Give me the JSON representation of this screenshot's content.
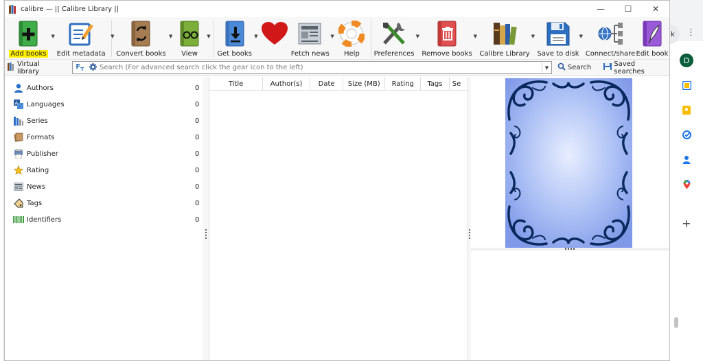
{
  "window": {
    "title": "calibre — || Calibre Library ||",
    "controls": {
      "minimize": "—",
      "maximize": "☐",
      "close": "✕"
    }
  },
  "toolbar": {
    "items": [
      {
        "label": "Add books",
        "highlighted": true,
        "dropdown": true
      },
      {
        "label": "Edit metadata",
        "dropdown": true
      },
      {
        "label": "Convert books",
        "dropdown": true
      },
      {
        "label": "View",
        "dropdown": true
      },
      {
        "label": "Get books",
        "dropdown": true
      },
      {
        "label": "",
        "dropdown": false
      },
      {
        "label": "Fetch news",
        "dropdown": true
      },
      {
        "label": "Help",
        "dropdown": false
      },
      {
        "label": "Preferences",
        "dropdown": true
      },
      {
        "label": "Remove books",
        "dropdown": true
      },
      {
        "label": "Calibre Library",
        "dropdown": true
      },
      {
        "label": "Save to disk",
        "dropdown": true
      },
      {
        "label": "Connect/share",
        "dropdown": false
      },
      {
        "label": "Edit book",
        "dropdown": false
      }
    ]
  },
  "searchbar": {
    "virtual_library": "Virtual library",
    "placeholder": "Search (For advanced search click the gear icon to the left)",
    "search_label": "Search",
    "saved_searches_label": "Saved searches"
  },
  "tag_browser": {
    "items": [
      {
        "label": "Authors",
        "count": "0"
      },
      {
        "label": "Languages",
        "count": "0"
      },
      {
        "label": "Series",
        "count": "0"
      },
      {
        "label": "Formats",
        "count": "0"
      },
      {
        "label": "Publisher",
        "count": "0"
      },
      {
        "label": "Rating",
        "count": "0"
      },
      {
        "label": "News",
        "count": "0"
      },
      {
        "label": "Tags",
        "count": "0"
      },
      {
        "label": "Identifiers",
        "count": "0"
      }
    ]
  },
  "book_list": {
    "columns": [
      "Title",
      "Author(s)",
      "Date",
      "Size (MB)",
      "Rating",
      "Tags",
      "Se"
    ]
  },
  "browser_side": {
    "avatar_letter": "D",
    "k_label": "k",
    "menu": "⋮",
    "add": "+"
  },
  "colors": {
    "highlight": "#ffee00",
    "cover_background": "#8aa4ee",
    "cover_ornament": "#0a2a5e",
    "avatar": "#0b5e3a"
  }
}
